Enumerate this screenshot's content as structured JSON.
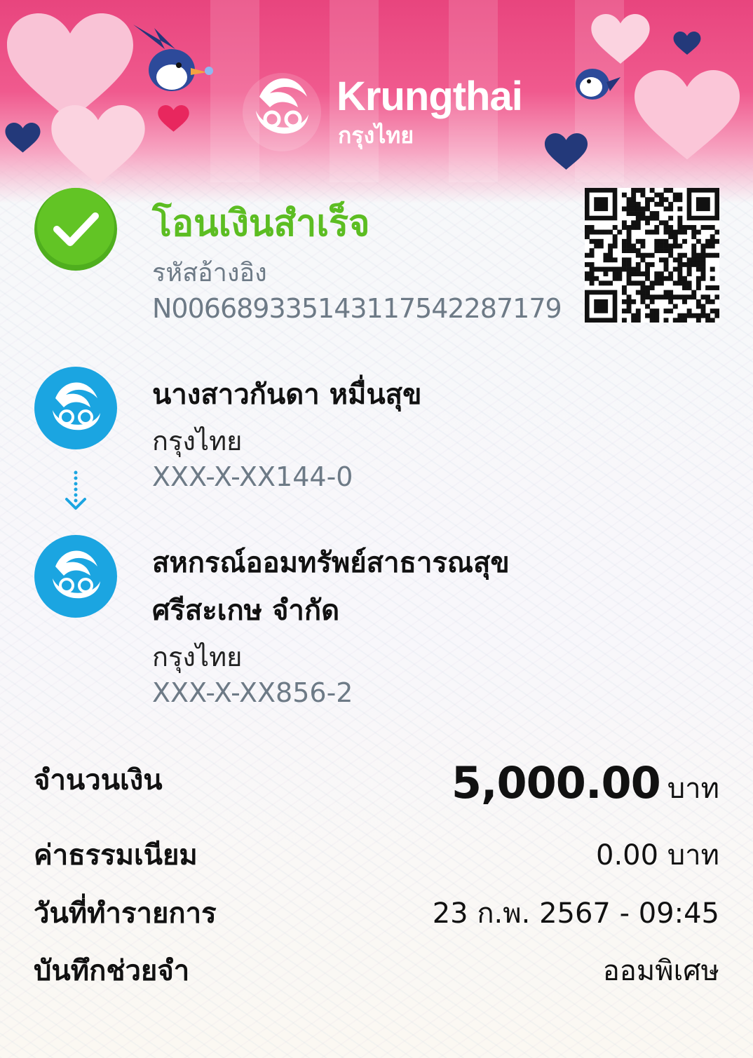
{
  "brand": {
    "name_en": "Krungthai",
    "name_th": "กรุงไทย"
  },
  "status": {
    "title": "โอนเงินสำเร็จ",
    "ref_label": "รหัสอ้างอิง",
    "ref_value": "N0066893351431175422871​79"
  },
  "sender": {
    "name": "นางสาวกันดา หมื่นสุข",
    "bank": "กรุงไทย",
    "account": "XXX-X-XX144-0"
  },
  "receiver": {
    "name_line1": "สหกรณ์ออมทรัพย์สาธารณสุข",
    "name_line2": "ศรีสะเกษ จำกัด",
    "bank": "กรุงไทย",
    "account": "XXX-X-XX856-2"
  },
  "details": {
    "amount_label": "จำนวนเงิน",
    "amount_value": "5,000.00",
    "amount_unit": "บาท",
    "fee_label": "ค่าธรรมเนียม",
    "fee_value": "0.00 บาท",
    "date_label": "วันที่ทำรายการ",
    "date_value": "23 ก.พ. 2567 - 09:45",
    "memo_label": "บันทึกช่วยจำ",
    "memo_value": "ออมพิเศษ"
  },
  "colors": {
    "success": "#5cbd22",
    "bank_blue": "#1ba5e1",
    "banner_pink": "#e8457e"
  },
  "icons": {
    "success": "check-circle-icon",
    "bank_logo": "krungthai-logo-icon",
    "transfer_arrow": "dotted-arrow-down-icon",
    "qr": "qr-code-icon"
  }
}
